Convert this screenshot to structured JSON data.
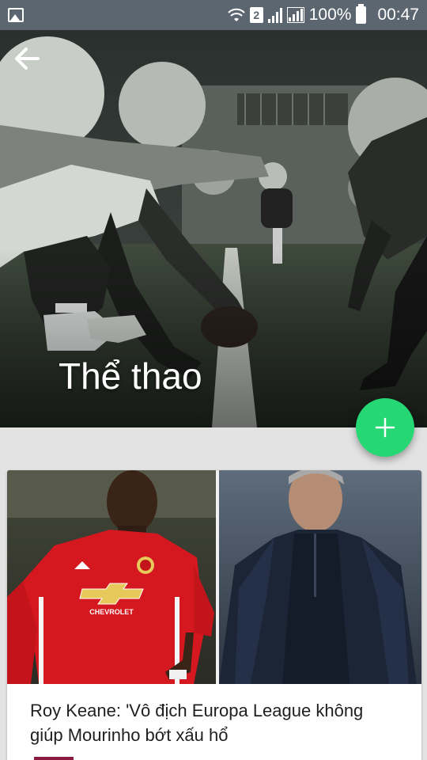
{
  "status_bar": {
    "battery_text": "100%",
    "time": "00:47",
    "sim_slot": "2"
  },
  "hero": {
    "title": "Thể thao",
    "image_description": "american-football-linemen-photo",
    "back_icon": "arrow-left-icon"
  },
  "fab": {
    "icon": "plus-icon",
    "color": "#26d873"
  },
  "articles": [
    {
      "title": "Roy Keane: 'Vô địch Europa League không giúp Mourinho bớt xấu hổ"
    }
  ],
  "colors": {
    "status_bar": "#5c6670",
    "background": "#e3e3e3",
    "accent": "#26d873",
    "tag": "#8a1b3e"
  }
}
